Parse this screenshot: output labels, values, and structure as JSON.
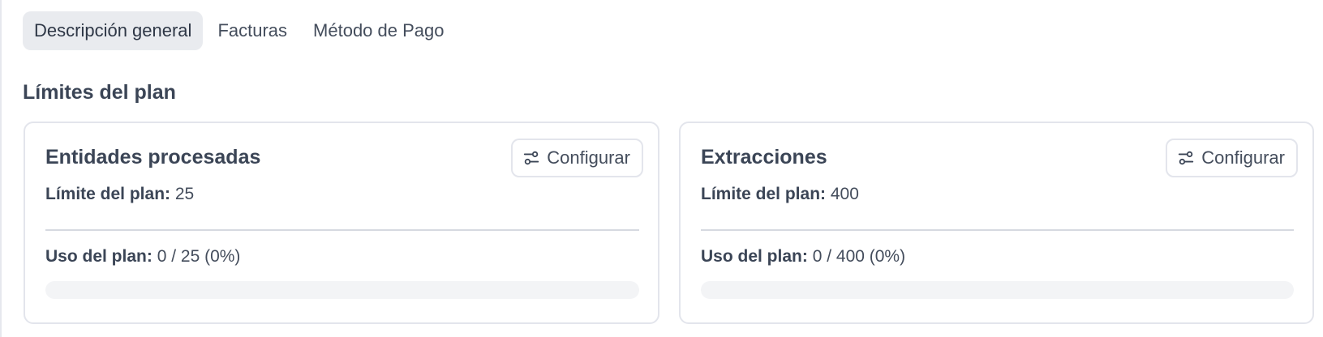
{
  "tabs": [
    {
      "label": "Descripción general",
      "active": true
    },
    {
      "label": "Facturas",
      "active": false
    },
    {
      "label": "Método de Pago",
      "active": false
    }
  ],
  "section_title": "Límites del plan",
  "cards": [
    {
      "title": "Entidades procesadas",
      "config_label": "Configurar",
      "config_icon": "sliders-icon",
      "limit_label": "Límite del plan:",
      "limit_value": "25",
      "usage_label": "Uso del plan:",
      "usage_value": "0 / 25 (0%)",
      "usage_fraction": 0
    },
    {
      "title": "Extracciones",
      "config_label": "Configurar",
      "config_icon": "sliders-icon",
      "limit_label": "Límite del plan:",
      "limit_value": "400",
      "usage_label": "Uso del plan:",
      "usage_value": "0 / 400 (0%)",
      "usage_fraction": 0
    }
  ],
  "colors": {
    "active_tab_bg": "#e9ebef",
    "card_border": "#e3e5ec",
    "progress_track": "#f3f4f6",
    "text": "#3b4556"
  }
}
